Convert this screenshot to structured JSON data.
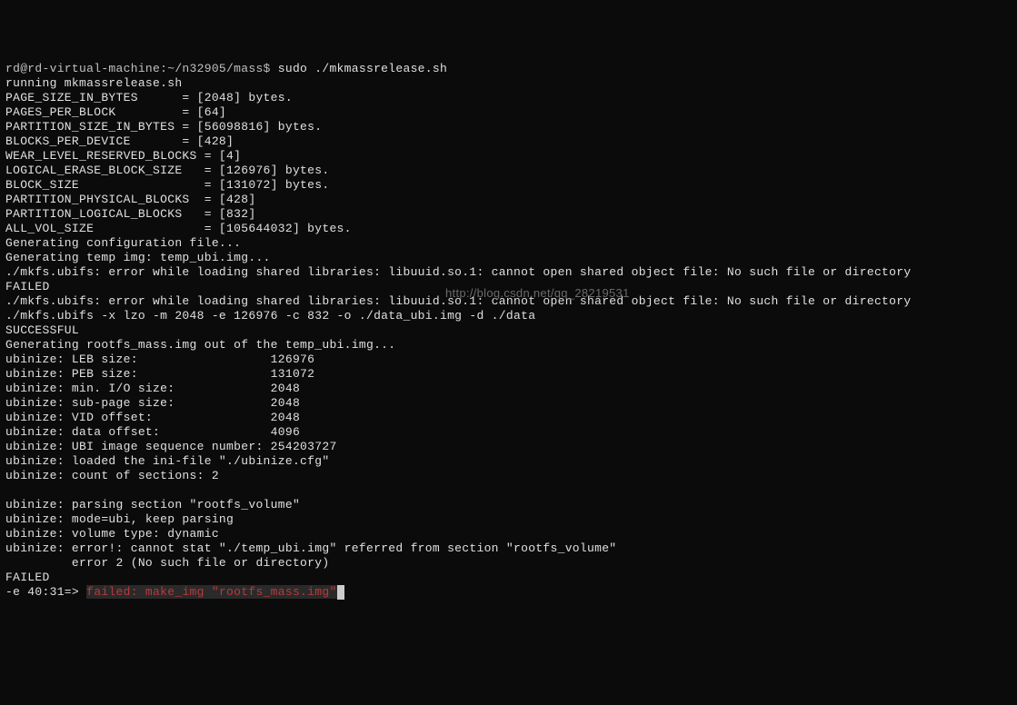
{
  "prompt": "rd@rd-virtual-machine:~/n32905/mass$ ",
  "command": "sudo ./mkmassrelease.sh",
  "lines": [
    "running mkmassrelease.sh",
    "PAGE_SIZE_IN_BYTES      = [2048] bytes.",
    "PAGES_PER_BLOCK         = [64]",
    "PARTITION_SIZE_IN_BYTES = [56098816] bytes.",
    "BLOCKS_PER_DEVICE       = [428]",
    "WEAR_LEVEL_RESERVED_BLOCKS = [4]",
    "LOGICAL_ERASE_BLOCK_SIZE   = [126976] bytes.",
    "BLOCK_SIZE                 = [131072] bytes.",
    "PARTITION_PHYSICAL_BLOCKS  = [428]",
    "PARTITION_LOGICAL_BLOCKS   = [832]",
    "ALL_VOL_SIZE               = [105644032] bytes.",
    "Generating configuration file...",
    "Generating temp img: temp_ubi.img...",
    "./mkfs.ubifs: error while loading shared libraries: libuuid.so.1: cannot open shared object file: No such file or directory",
    "FAILED",
    "./mkfs.ubifs: error while loading shared libraries: libuuid.so.1: cannot open shared object file: No such file or directory",
    "./mkfs.ubifs -x lzo -m 2048 -e 126976 -c 832 -o ./data_ubi.img -d ./data",
    "SUCCESSFUL",
    "Generating rootfs_mass.img out of the temp_ubi.img...",
    "ubinize: LEB size:                  126976",
    "ubinize: PEB size:                  131072",
    "ubinize: min. I/O size:             2048",
    "ubinize: sub-page size:             2048",
    "ubinize: VID offset:                2048",
    "ubinize: data offset:               4096",
    "ubinize: UBI image sequence number: 254203727",
    "ubinize: loaded the ini-file \"./ubinize.cfg\"",
    "ubinize: count of sections: 2",
    "",
    "ubinize: parsing section \"rootfs_volume\"",
    "ubinize: mode=ubi, keep parsing",
    "ubinize: volume type: dynamic",
    "ubinize: error!: cannot stat \"./temp_ubi.img\" referred from section \"rootfs_volume\"",
    "         error 2 (No such file or directory)",
    "FAILED"
  ],
  "error_line": {
    "prefix": "-e 40:31=> ",
    "msg": "failed: make_img \"rootfs_mass.img\""
  },
  "watermark": "http://blog.csdn.net/qq_28219531"
}
